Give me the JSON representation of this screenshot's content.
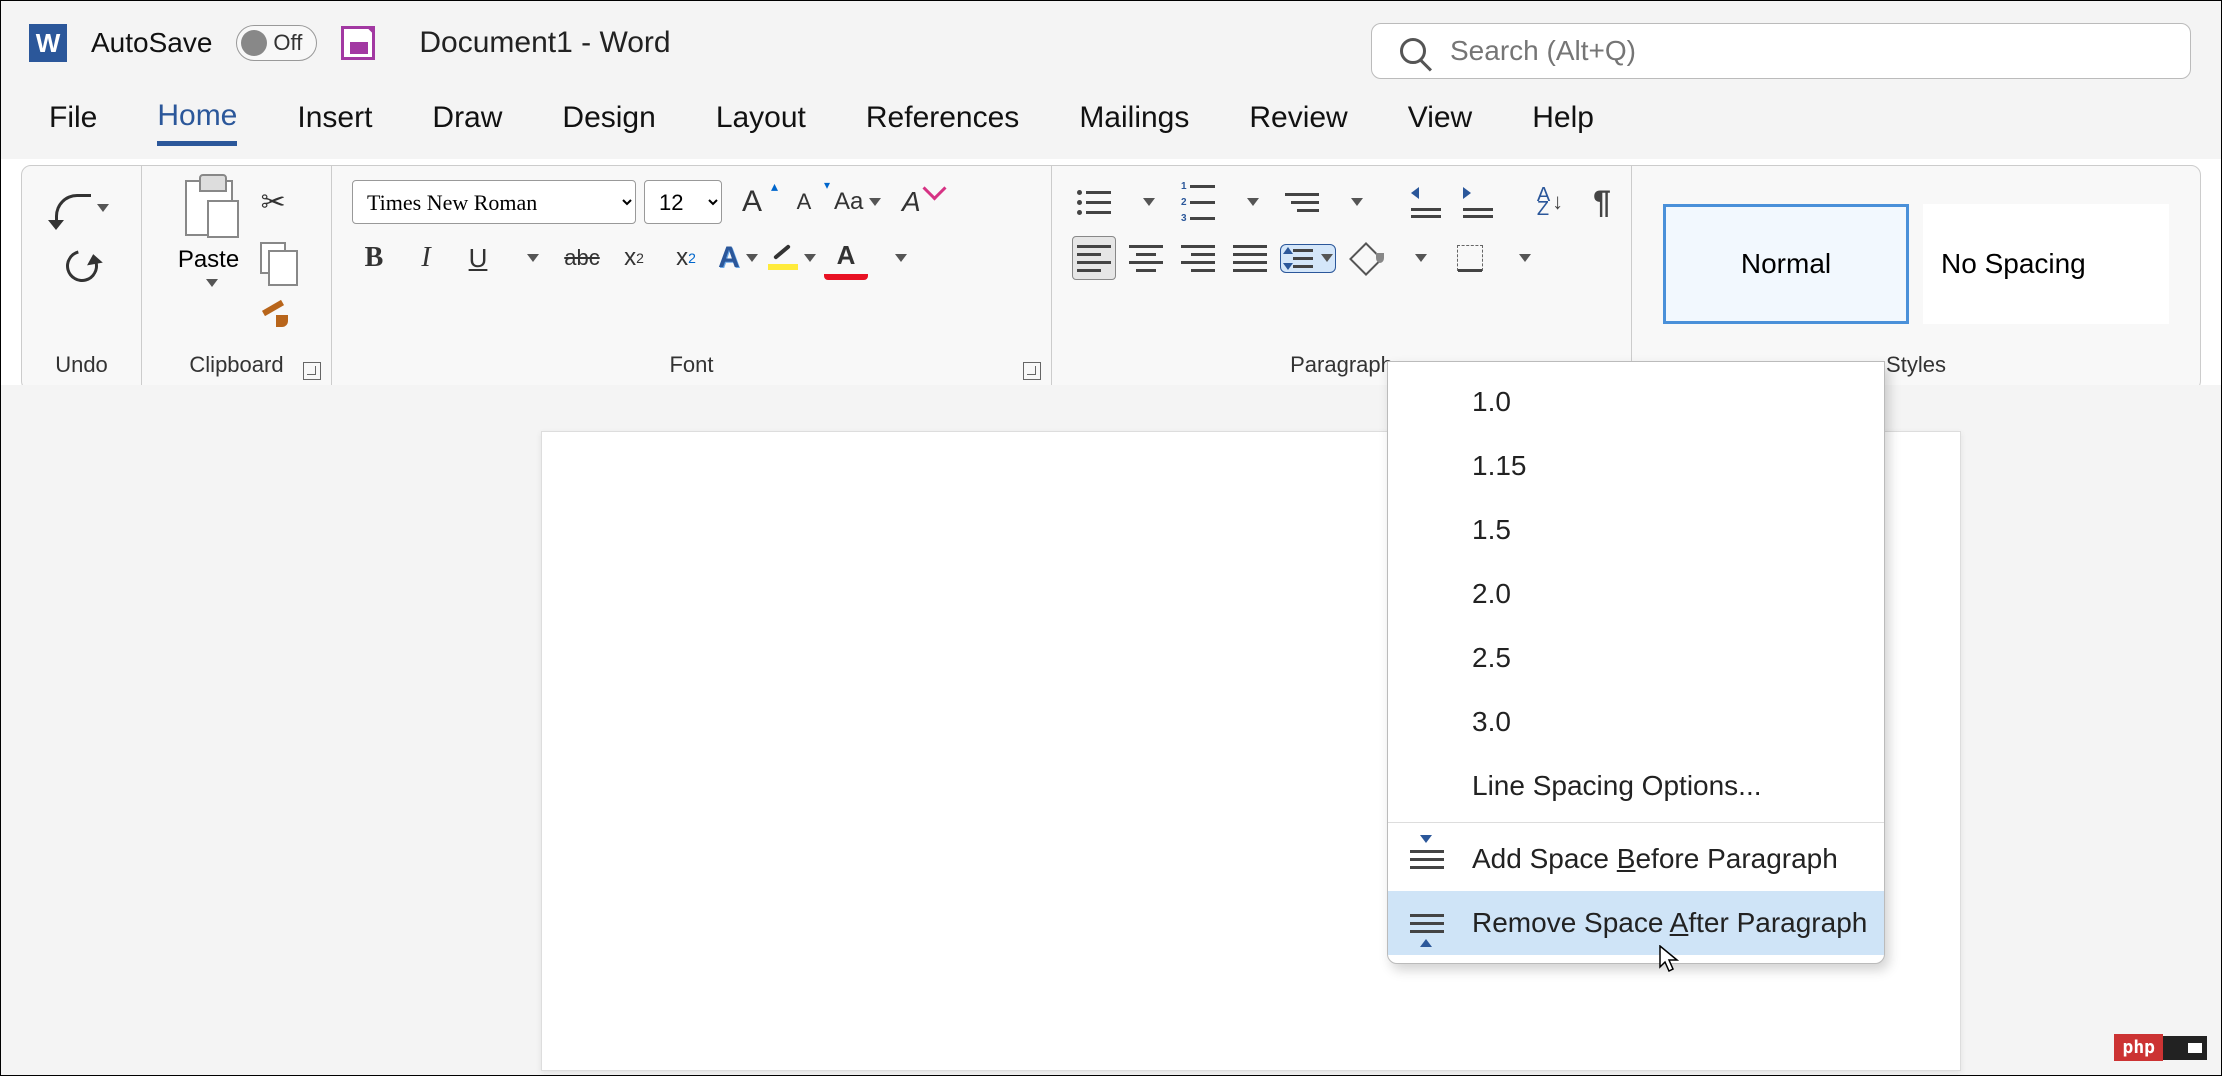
{
  "titlebar": {
    "autosave_label": "AutoSave",
    "autosave_state": "Off",
    "doc_title": "Document1  -  Word"
  },
  "search": {
    "placeholder": "Search (Alt+Q)"
  },
  "tabs": {
    "file": "File",
    "home": "Home",
    "insert": "Insert",
    "draw": "Draw",
    "design": "Design",
    "layout": "Layout",
    "references": "References",
    "mailings": "Mailings",
    "review": "Review",
    "view": "View",
    "help": "Help"
  },
  "ribbon": {
    "undo_label": "Undo",
    "clipboard_label": "Clipboard",
    "paste_label": "Paste",
    "font_label": "Font",
    "paragraph_label": "Paragraph",
    "styles_label": "Styles",
    "font_name": "Times New Roman",
    "font_size": "12",
    "case_text": "Aa",
    "clear_a": "A",
    "bold": "B",
    "italic": "I",
    "under": "U",
    "strike": "abc",
    "subx": "x",
    "sub2": "2",
    "supx": "x",
    "sup2": "2",
    "effectA": "A",
    "fontcolorA": "A",
    "sortAZ": "A\nZ",
    "pilcrow": "¶",
    "style_normal": "Normal",
    "style_nospacing": "No Spacing"
  },
  "linespacing": {
    "v1": "1.0",
    "v2": "1.15",
    "v3": "1.5",
    "v4": "2.0",
    "v5": "2.5",
    "v6": "3.0",
    "options": "Line Spacing Options...",
    "add_before_pre": "Add Space ",
    "add_before_u": "B",
    "add_before_post": "efore Paragraph",
    "remove_after_pre": "Remove Space ",
    "remove_after_u": "A",
    "remove_after_post": "fter Paragraph"
  },
  "badge": {
    "php": "php"
  }
}
